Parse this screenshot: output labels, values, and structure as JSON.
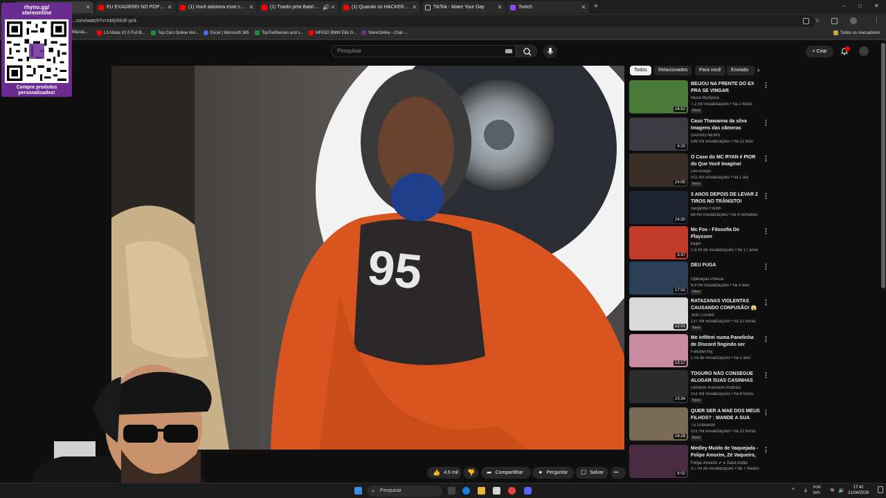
{
  "browser": {
    "tabs": [
      {
        "title": "th",
        "favicon_color": "#ff0000",
        "active": true
      },
      {
        "title": "EU EXAGEREI NO POPEYES... O...",
        "favicon_color": "#ff0000",
        "active": false
      },
      {
        "title": "(1) Você adotaria esse cachorro",
        "favicon_color": "#ff0000",
        "active": false
      },
      {
        "title": "(1) Traído pela Babilônia, 8",
        "favicon_color": "#ff0000",
        "active": false
      },
      {
        "title": "(1) Quando os HACKERS ENFR",
        "favicon_color": "#ff0000",
        "active": false
      },
      {
        "title": "TikTok - Make Your Day",
        "favicon_color": "#222222",
        "active": false
      },
      {
        "title": "Twitch",
        "favicon_color": "#9146ff",
        "active": false
      }
    ],
    "new_tab_label": "+",
    "window_controls": [
      "–",
      "□",
      "✕"
    ],
    "url": "...com/watch?v=nMjXRcE-prA",
    "bookmarks": [
      {
        "label": "Mazda...",
        "color": "#888888"
      },
      {
        "label": "LS Miata V2.0 Full B...",
        "color": "#ff0000"
      },
      {
        "label": "Top Cars Online Hor...",
        "color": "#1e8e3e"
      },
      {
        "label": "Excel | Microsoft 365",
        "color": "#4a6cf7"
      },
      {
        "label": "TopTierRamen and s...",
        "color": "#1e8e3e"
      },
      {
        "label": "MFD32 BMW E8x G...",
        "color": "#ff0000"
      },
      {
        "label": "StereOnline - Chat -...",
        "color": "#6a2c91"
      }
    ],
    "all_bookmarks_label": "Todos os marcadores"
  },
  "overlay": {
    "qr_title_line1": "rhyno.gg/",
    "qr_title_line2": "stereonline",
    "qr_caption_line1": "Compre produtos",
    "qr_caption_line2": "personalizados!"
  },
  "masthead": {
    "search_placeholder": "Pesquisar",
    "create_label": "Criar",
    "create_icon": "+"
  },
  "video_actions": {
    "likes": "4,6 mil",
    "share": "Compartilhar",
    "ask": "Perguntar",
    "save": "Salvar",
    "more": "•••"
  },
  "chips": [
    {
      "label": "Todos",
      "selected": true
    },
    {
      "label": "Relacionados",
      "selected": false
    },
    {
      "label": "Para você",
      "selected": false
    },
    {
      "label": "Enviado",
      "selected": false
    }
  ],
  "recommendations": [
    {
      "title": "BEIJOU NA FRENTE DO EX PRA SE VINGAR",
      "channel": "Muca Muriçoca",
      "meta": "7,2 mil visualizações • há 2 horas",
      "badge": "Novo",
      "duration": "16:52",
      "thumb": "#4a7a3a",
      "more": "⋮"
    },
    {
      "title": "Caso Thawanna da silva Imagens das câmeras corpora...",
      "channel": "GAVIÃO NEWS",
      "meta": "199 mil visualizações • há 12 dias",
      "badge": "",
      "duration": "4:20",
      "thumb": "#3a3a40",
      "more": "⋮"
    },
    {
      "title": "O Caso do MC RYAN é PIOR do Que Você Imagina!",
      "channel": "Léo Araújo",
      "meta": "411 mil visualizações • há 1 dia",
      "badge": "Novo",
      "duration": "24:05",
      "thumb": "#3b2f2a",
      "more": "⋮"
    },
    {
      "title": "3 ANOS DEPOIS DE LEVAR 2 TIROS NO TRÂNSITO!",
      "channel": "Sergiinho Fiooth",
      "meta": "88 mil visualizações • há 4 semanas",
      "badge": "",
      "duration": "24:30",
      "thumb": "#1d2330",
      "more": "⋮"
    },
    {
      "title": "Mc Fox - Filosofia De Playsson",
      "channel": "kaijet",
      "meta": "1,9 mi de visualizações • há 17 anos",
      "badge": "",
      "duration": "3:37",
      "thumb": "#c23a2a",
      "more": "⋮"
    },
    {
      "title": "DEU FUGA",
      "channel": "Operação Policial",
      "meta": "9,9 mil visualizações • há 4 dias",
      "badge": "Novo",
      "duration": "17:02",
      "thumb": "#2a3f55",
      "more": "⋮"
    },
    {
      "title": "RATAZANAS VIOLENTAS CAUSANDO CONFUSÃO! 😱 ...",
      "channel": "Julio Cocielo",
      "meta": "137 mil visualizações • há 22 horas",
      "badge": "Novo",
      "duration": "12:01",
      "thumb": "#d9d9d9",
      "more": "⋮"
    },
    {
      "title": "Me infiltrei numa Panelinha de Discord fingindo ser Mulher...",
      "channel": "Fukubei Kkj",
      "meta": "1 mi de visualizações • há 1 ano",
      "badge": "",
      "duration": "13:17",
      "thumb": "#c98aa0",
      "more": "⋮"
    },
    {
      "title": "TOGURO NÃO CONSEGUE ALUGAR SUAS CASINHAS NA ...",
      "channel": "Gêmeos Investem Podcast",
      "meta": "151 mil visualizações • há 8 horas",
      "badge": "Novo",
      "duration": "23:34",
      "thumb": "#2c2c2c",
      "more": "⋮"
    },
    {
      "title": "QUER SER A MAE DOS MEUS FILHOS? : MANDE A SUA #378",
      "channel": "Tá Gravando",
      "meta": "151 mil visualizações • há 22 horas",
      "badge": "Novo",
      "duration": "16:26",
      "thumb": "#7a6a55",
      "more": "⋮"
    },
    {
      "title": "Medley Muído de Vaquejada - Felipe Amorim, Zé Vaqueiro, ...",
      "channel": "Felipe Amorim ✔ e Xand Avião",
      "meta": "3,7 mi de visualizações • há 7 meses",
      "badge": "",
      "duration": "6:02",
      "thumb": "#4a2a40",
      "more": "⋮"
    }
  ],
  "taskbar": {
    "search_placeholder": "Pesquisar",
    "lang_line1": "POR",
    "lang_line2": "INTL",
    "time": "17:42",
    "date": "21/04/2026"
  },
  "colors": {
    "youtube_bg": "#0f0f0f",
    "overlay_purple": "#6a2c91",
    "video_orange": "#d9541e"
  }
}
